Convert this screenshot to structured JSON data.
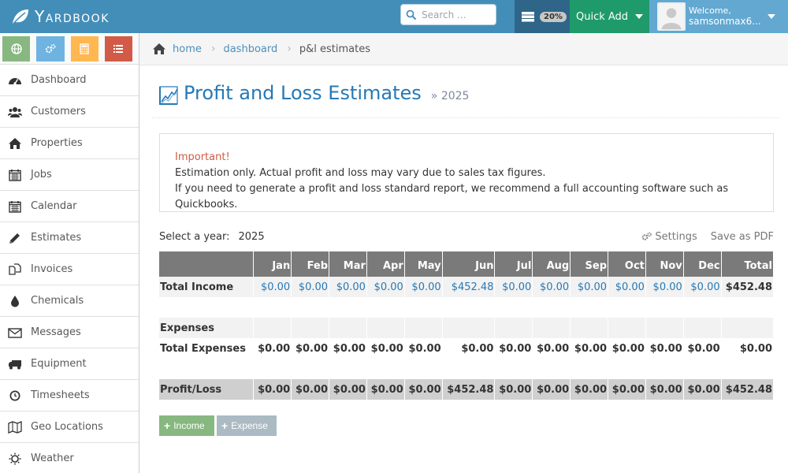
{
  "navbar": {
    "brand": "Yardbook",
    "search_placeholder": "Search ...",
    "server_usage": "20%",
    "quick_add_label": "Quick Add",
    "welcome_label": "Welcome,",
    "username": "samsonmax6..."
  },
  "shortcuts": [
    {
      "name": "globe-icon",
      "color": "#87b87f"
    },
    {
      "name": "cogs-icon",
      "color": "#6fb3e0"
    },
    {
      "name": "calculator-icon",
      "color": "#ffb752"
    },
    {
      "name": "list-icon",
      "color": "#d15b47"
    }
  ],
  "sidebar": {
    "items": [
      {
        "label": "Dashboard",
        "icon": "dashboard-icon"
      },
      {
        "label": "Customers",
        "icon": "users-icon"
      },
      {
        "label": "Properties",
        "icon": "home-icon"
      },
      {
        "label": "Jobs",
        "icon": "calendar-grid-icon"
      },
      {
        "label": "Calendar",
        "icon": "calendar-icon"
      },
      {
        "label": "Estimates",
        "icon": "pencil-icon"
      },
      {
        "label": "Invoices",
        "icon": "copy-icon"
      },
      {
        "label": "Chemicals",
        "icon": "drop-icon"
      },
      {
        "label": "Messages",
        "icon": "envelope-icon"
      },
      {
        "label": "Equipment",
        "icon": "truck-icon"
      },
      {
        "label": "Timesheets",
        "icon": "clock-icon"
      },
      {
        "label": "Geo Locations",
        "icon": "map-icon"
      },
      {
        "label": "Weather",
        "icon": "sun-icon"
      }
    ]
  },
  "breadcrumbs": {
    "home": "home",
    "dashboard": "dashboard",
    "current": "p&l estimates"
  },
  "page": {
    "title": "Profit and Loss Estimates",
    "subtitle": "» 2025"
  },
  "alert": {
    "title": "Important!",
    "line1": "Estimation only. Actual profit and loss may vary due to sales tax figures.",
    "line2": "If you need to generate a profit and loss standard report, we recommend a full accounting software such as Quickbooks."
  },
  "year": {
    "label": "Select a year:",
    "value": "2025",
    "settings_label": "Settings",
    "pdf_label": "Save as PDF"
  },
  "table": {
    "columns": [
      "Jan",
      "Feb",
      "Mar",
      "Apr",
      "May",
      "Jun",
      "Jul",
      "Aug",
      "Sep",
      "Oct",
      "Nov",
      "Dec",
      "Total"
    ],
    "income": {
      "label": "Total Income",
      "values": [
        "$0.00",
        "$0.00",
        "$0.00",
        "$0.00",
        "$0.00",
        "$452.48",
        "$0.00",
        "$0.00",
        "$0.00",
        "$0.00",
        "$0.00",
        "$0.00",
        "$452.48"
      ]
    },
    "expenses_label": "Expenses",
    "expenses_total": {
      "label": "Total Expenses",
      "values": [
        "$0.00",
        "$0.00",
        "$0.00",
        "$0.00",
        "$0.00",
        "$0.00",
        "$0.00",
        "$0.00",
        "$0.00",
        "$0.00",
        "$0.00",
        "$0.00",
        "$0.00"
      ]
    },
    "profit": {
      "label": "Profit/Loss",
      "values": [
        "$0.00",
        "$0.00",
        "$0.00",
        "$0.00",
        "$0.00",
        "$452.48",
        "$0.00",
        "$0.00",
        "$0.00",
        "$0.00",
        "$0.00",
        "$0.00",
        "$452.48"
      ]
    }
  },
  "buttons": {
    "income": "Income",
    "expense": "Expense"
  }
}
